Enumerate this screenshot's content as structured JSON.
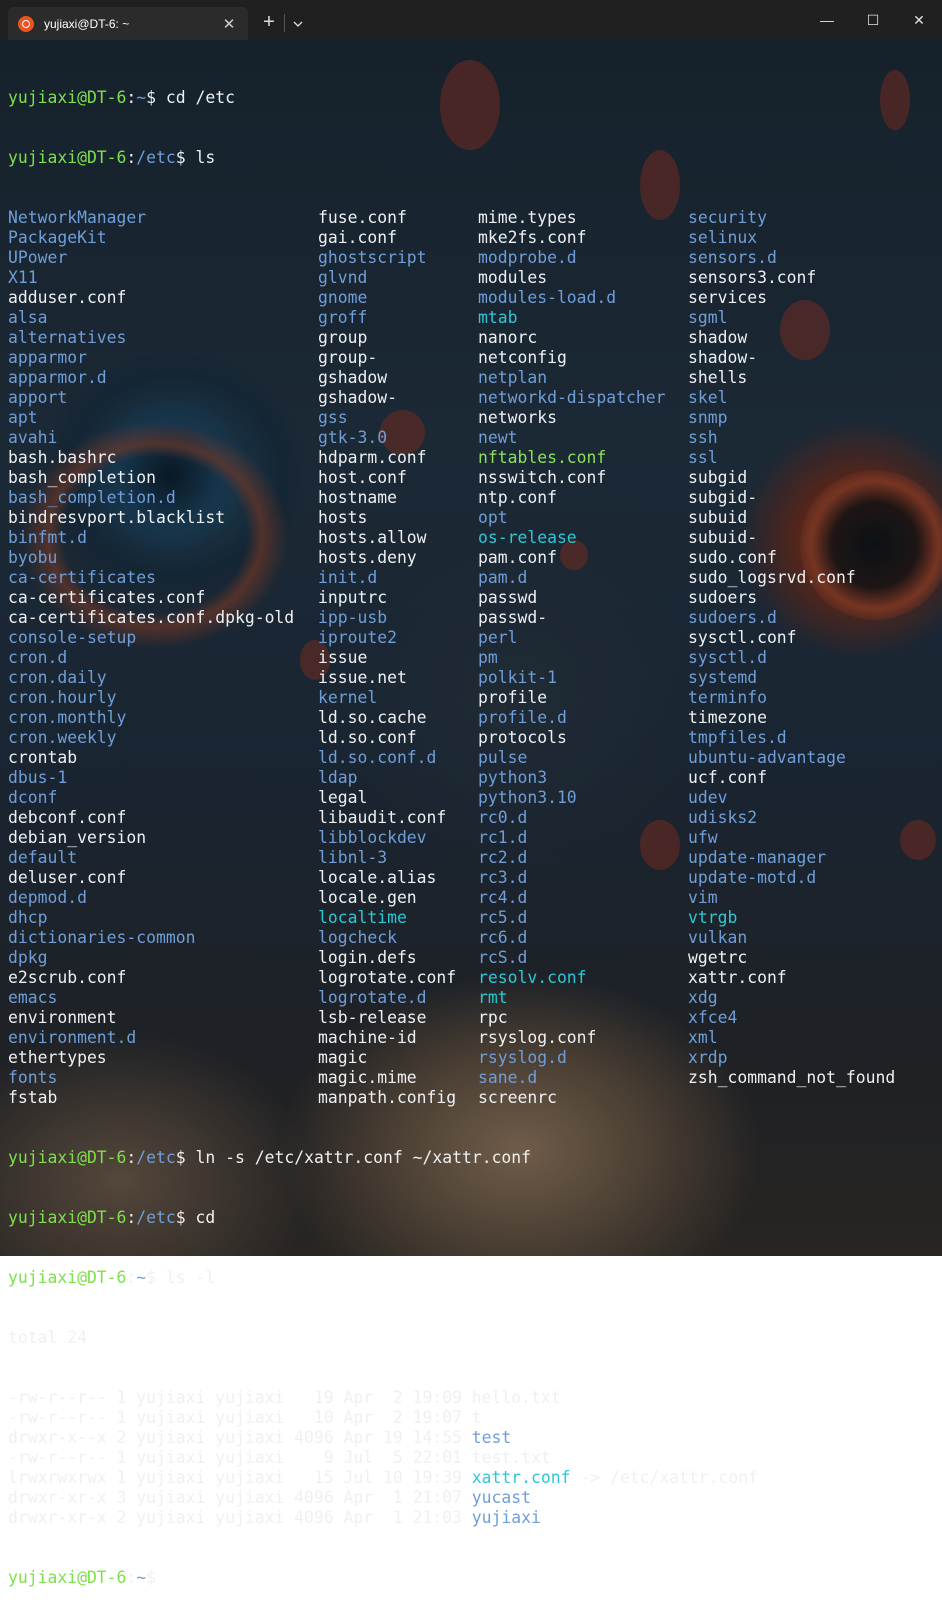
{
  "window": {
    "tab_title": "yujiaxi@DT-6: ~",
    "tab_close": "✕",
    "new_tab": "+",
    "dropdown_icon": "chevron-down-icon",
    "minimize": "—",
    "maximize": "☐",
    "close": "✕",
    "accent": "#e95420"
  },
  "terminal": {
    "user": "yujiaxi@DT-6",
    "cmd1": {
      "path": "~",
      "cmd": " cd /etc"
    },
    "cmd2": {
      "path": "/etc",
      "cmd": " ls"
    },
    "listing": [
      [
        [
          "NetworkManager",
          "d"
        ],
        [
          "fuse.conf",
          "f"
        ],
        [
          "mime.types",
          "f"
        ],
        [
          "security",
          "d"
        ]
      ],
      [
        [
          "PackageKit",
          "d"
        ],
        [
          "gai.conf",
          "f"
        ],
        [
          "mke2fs.conf",
          "f"
        ],
        [
          "selinux",
          "d"
        ]
      ],
      [
        [
          "UPower",
          "d"
        ],
        [
          "ghostscript",
          "d"
        ],
        [
          "modprobe.d",
          "d"
        ],
        [
          "sensors.d",
          "d"
        ]
      ],
      [
        [
          "X11",
          "d"
        ],
        [
          "glvnd",
          "d"
        ],
        [
          "modules",
          "f"
        ],
        [
          "sensors3.conf",
          "f"
        ]
      ],
      [
        [
          "adduser.conf",
          "f"
        ],
        [
          "gnome",
          "d"
        ],
        [
          "modules-load.d",
          "d"
        ],
        [
          "services",
          "f"
        ]
      ],
      [
        [
          "alsa",
          "d"
        ],
        [
          "groff",
          "d"
        ],
        [
          "mtab",
          "l"
        ],
        [
          "sgml",
          "d"
        ]
      ],
      [
        [
          "alternatives",
          "d"
        ],
        [
          "group",
          "f"
        ],
        [
          "nanorc",
          "f"
        ],
        [
          "shadow",
          "f"
        ]
      ],
      [
        [
          "apparmor",
          "d"
        ],
        [
          "group-",
          "f"
        ],
        [
          "netconfig",
          "f"
        ],
        [
          "shadow-",
          "f"
        ]
      ],
      [
        [
          "apparmor.d",
          "d"
        ],
        [
          "gshadow",
          "f"
        ],
        [
          "netplan",
          "d"
        ],
        [
          "shells",
          "f"
        ]
      ],
      [
        [
          "apport",
          "d"
        ],
        [
          "gshadow-",
          "f"
        ],
        [
          "networkd-dispatcher",
          "d"
        ],
        [
          "skel",
          "d"
        ]
      ],
      [
        [
          "apt",
          "d"
        ],
        [
          "gss",
          "d"
        ],
        [
          "networks",
          "f"
        ],
        [
          "snmp",
          "d"
        ]
      ],
      [
        [
          "avahi",
          "d"
        ],
        [
          "gtk-3.0",
          "d"
        ],
        [
          "newt",
          "d"
        ],
        [
          "ssh",
          "d"
        ]
      ],
      [
        [
          "bash.bashrc",
          "f"
        ],
        [
          "hdparm.conf",
          "f"
        ],
        [
          "nftables.conf",
          "x"
        ],
        [
          "ssl",
          "d"
        ]
      ],
      [
        [
          "bash_completion",
          "f"
        ],
        [
          "host.conf",
          "f"
        ],
        [
          "nsswitch.conf",
          "f"
        ],
        [
          "subgid",
          "f"
        ]
      ],
      [
        [
          "bash_completion.d",
          "d"
        ],
        [
          "hostname",
          "f"
        ],
        [
          "ntp.conf",
          "f"
        ],
        [
          "subgid-",
          "f"
        ]
      ],
      [
        [
          "bindresvport.blacklist",
          "f"
        ],
        [
          "hosts",
          "f"
        ],
        [
          "opt",
          "d"
        ],
        [
          "subuid",
          "f"
        ]
      ],
      [
        [
          "binfmt.d",
          "d"
        ],
        [
          "hosts.allow",
          "f"
        ],
        [
          "os-release",
          "l"
        ],
        [
          "subuid-",
          "f"
        ]
      ],
      [
        [
          "byobu",
          "d"
        ],
        [
          "hosts.deny",
          "f"
        ],
        [
          "pam.conf",
          "f"
        ],
        [
          "sudo.conf",
          "f"
        ]
      ],
      [
        [
          "ca-certificates",
          "d"
        ],
        [
          "init.d",
          "d"
        ],
        [
          "pam.d",
          "d"
        ],
        [
          "sudo_logsrvd.conf",
          "f"
        ]
      ],
      [
        [
          "ca-certificates.conf",
          "f"
        ],
        [
          "inputrc",
          "f"
        ],
        [
          "passwd",
          "f"
        ],
        [
          "sudoers",
          "f"
        ]
      ],
      [
        [
          "ca-certificates.conf.dpkg-old",
          "f"
        ],
        [
          "ipp-usb",
          "d"
        ],
        [
          "passwd-",
          "f"
        ],
        [
          "sudoers.d",
          "d"
        ]
      ],
      [
        [
          "console-setup",
          "d"
        ],
        [
          "iproute2",
          "d"
        ],
        [
          "perl",
          "d"
        ],
        [
          "sysctl.conf",
          "f"
        ]
      ],
      [
        [
          "cron.d",
          "d"
        ],
        [
          "issue",
          "f"
        ],
        [
          "pm",
          "d"
        ],
        [
          "sysctl.d",
          "d"
        ]
      ],
      [
        [
          "cron.daily",
          "d"
        ],
        [
          "issue.net",
          "f"
        ],
        [
          "polkit-1",
          "d"
        ],
        [
          "systemd",
          "d"
        ]
      ],
      [
        [
          "cron.hourly",
          "d"
        ],
        [
          "kernel",
          "d"
        ],
        [
          "profile",
          "f"
        ],
        [
          "terminfo",
          "d"
        ]
      ],
      [
        [
          "cron.monthly",
          "d"
        ],
        [
          "ld.so.cache",
          "f"
        ],
        [
          "profile.d",
          "d"
        ],
        [
          "timezone",
          "f"
        ]
      ],
      [
        [
          "cron.weekly",
          "d"
        ],
        [
          "ld.so.conf",
          "f"
        ],
        [
          "protocols",
          "f"
        ],
        [
          "tmpfiles.d",
          "d"
        ]
      ],
      [
        [
          "crontab",
          "f"
        ],
        [
          "ld.so.conf.d",
          "d"
        ],
        [
          "pulse",
          "d"
        ],
        [
          "ubuntu-advantage",
          "d"
        ]
      ],
      [
        [
          "dbus-1",
          "d"
        ],
        [
          "ldap",
          "d"
        ],
        [
          "python3",
          "d"
        ],
        [
          "ucf.conf",
          "f"
        ]
      ],
      [
        [
          "dconf",
          "d"
        ],
        [
          "legal",
          "f"
        ],
        [
          "python3.10",
          "d"
        ],
        [
          "udev",
          "d"
        ]
      ],
      [
        [
          "debconf.conf",
          "f"
        ],
        [
          "libaudit.conf",
          "f"
        ],
        [
          "rc0.d",
          "d"
        ],
        [
          "udisks2",
          "d"
        ]
      ],
      [
        [
          "debian_version",
          "f"
        ],
        [
          "libblockdev",
          "d"
        ],
        [
          "rc1.d",
          "d"
        ],
        [
          "ufw",
          "d"
        ]
      ],
      [
        [
          "default",
          "d"
        ],
        [
          "libnl-3",
          "d"
        ],
        [
          "rc2.d",
          "d"
        ],
        [
          "update-manager",
          "d"
        ]
      ],
      [
        [
          "deluser.conf",
          "f"
        ],
        [
          "locale.alias",
          "f"
        ],
        [
          "rc3.d",
          "d"
        ],
        [
          "update-motd.d",
          "d"
        ]
      ],
      [
        [
          "depmod.d",
          "d"
        ],
        [
          "locale.gen",
          "f"
        ],
        [
          "rc4.d",
          "d"
        ],
        [
          "vim",
          "d"
        ]
      ],
      [
        [
          "dhcp",
          "d"
        ],
        [
          "localtime",
          "l"
        ],
        [
          "rc5.d",
          "d"
        ],
        [
          "vtrgb",
          "l"
        ]
      ],
      [
        [
          "dictionaries-common",
          "d"
        ],
        [
          "logcheck",
          "d"
        ],
        [
          "rc6.d",
          "d"
        ],
        [
          "vulkan",
          "d"
        ]
      ],
      [
        [
          "dpkg",
          "d"
        ],
        [
          "login.defs",
          "f"
        ],
        [
          "rcS.d",
          "d"
        ],
        [
          "wgetrc",
          "f"
        ]
      ],
      [
        [
          "e2scrub.conf",
          "f"
        ],
        [
          "logrotate.conf",
          "f"
        ],
        [
          "resolv.conf",
          "l"
        ],
        [
          "xattr.conf",
          "f"
        ]
      ],
      [
        [
          "emacs",
          "d"
        ],
        [
          "logrotate.d",
          "d"
        ],
        [
          "rmt",
          "l"
        ],
        [
          "xdg",
          "d"
        ]
      ],
      [
        [
          "environment",
          "f"
        ],
        [
          "lsb-release",
          "f"
        ],
        [
          "rpc",
          "f"
        ],
        [
          "xfce4",
          "d"
        ]
      ],
      [
        [
          "environment.d",
          "d"
        ],
        [
          "machine-id",
          "f"
        ],
        [
          "rsyslog.conf",
          "f"
        ],
        [
          "xml",
          "d"
        ]
      ],
      [
        [
          "ethertypes",
          "f"
        ],
        [
          "magic",
          "f"
        ],
        [
          "rsyslog.d",
          "d"
        ],
        [
          "xrdp",
          "d"
        ]
      ],
      [
        [
          "fonts",
          "d"
        ],
        [
          "magic.mime",
          "f"
        ],
        [
          "sane.d",
          "d"
        ],
        [
          "zsh_command_not_found",
          "f"
        ]
      ],
      [
        [
          "fstab",
          "f"
        ],
        [
          "manpath.config",
          "f"
        ],
        [
          "screenrc",
          "f"
        ],
        [
          "",
          ""
        ]
      ]
    ],
    "cmd3": {
      "path": "/etc",
      "cmd": " ln -s /etc/xattr.conf ~/xattr.conf"
    },
    "cmd4": {
      "path": "/etc",
      "cmd": " cd"
    },
    "cmd5": {
      "path": "~",
      "cmd": " ls -l"
    },
    "total": "total 24",
    "long_listing": [
      {
        "meta": "-rw-r--r-- 1 yujiaxi yujiaxi   19 Apr  2 19:09 ",
        "name": "hello.txt",
        "type": "f",
        "target": ""
      },
      {
        "meta": "-rw-r--r-- 1 yujiaxi yujiaxi   10 Apr  2 19:07 ",
        "name": "t",
        "type": "f",
        "target": ""
      },
      {
        "meta": "drwxr-x--x 2 yujiaxi yujiaxi 4096 Apr 19 14:55 ",
        "name": "test",
        "type": "d",
        "target": ""
      },
      {
        "meta": "-rw-r--r-- 1 yujiaxi yujiaxi    9 Jul  5 22:01 ",
        "name": "test.txt",
        "type": "f",
        "target": ""
      },
      {
        "meta": "lrwxrwxrwx 1 yujiaxi yujiaxi   15 Jul 10 19:39 ",
        "name": "xattr.conf",
        "type": "l",
        "target": " -> /etc/xattr.conf"
      },
      {
        "meta": "drwxr-xr-x 3 yujiaxi yujiaxi 4096 Apr  1 21:07 ",
        "name": "yucast",
        "type": "d",
        "target": ""
      },
      {
        "meta": "drwxr-xr-x 2 yujiaxi yujiaxi 4096 Apr  1 21:03 ",
        "name": "yujiaxi",
        "type": "d",
        "target": ""
      }
    ],
    "final_prompt_path": "~",
    "colors": {
      "user": "#7ee04a",
      "path": "#6f9ed8",
      "directory": "#6f9ed8",
      "symlink": "#2bc8d8",
      "executable": "#8ee05a",
      "text": "#eef0f2"
    }
  }
}
